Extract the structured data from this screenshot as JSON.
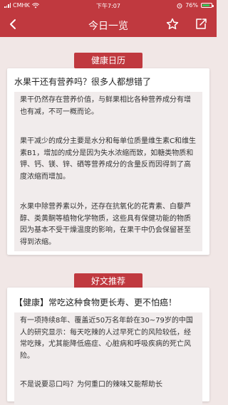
{
  "status_bar": {
    "carrier": "CMHK",
    "time": "下午7:07",
    "battery": "76%"
  },
  "nav": {
    "title": "今日一览",
    "back_icon": "chevron-left-icon",
    "favorite_icon": "star-icon",
    "share_icon": "share-icon"
  },
  "sections": [
    {
      "tag": "健康日历",
      "title": "水果干还有营养吗？很多人都想错了",
      "paragraphs": [
        "果干仍然存在营养价值，与鲜果相比各种营养成分有增也有减，不可一概而论。",
        "果干减少的成分主要是水分和每单位质量维生素C和维生素B1，增加的成分是因为失水浓缩而致，如糖类物质和钾、钙、镁、锌、硒等营养成分的含量反而因得到了高度浓缩而增加。",
        "水果中除营养素以外，还存在抗氧化的花青素、白藜芦醇、类黄酮等植物化学物质，这些具有保健功能的物质因为基本不受干燥温度的影响，在果干中仍会保留甚至得到浓缩。"
      ]
    },
    {
      "tag": "好文推荐",
      "title": "【健康】常吃这种食物更长寿、更不怕癌！",
      "paragraphs": [
        "有一项持续8年、覆盖近50万名年龄在30~79岁的中国人的研究显示：每天吃辣的人过早死亡的风险较低，经常吃辣，尤其能降低癌症、心脏病和呼吸疾病的死亡风险。",
        "不是说要忌口吗？为何重口的辣味又能帮助长"
      ]
    }
  ]
}
